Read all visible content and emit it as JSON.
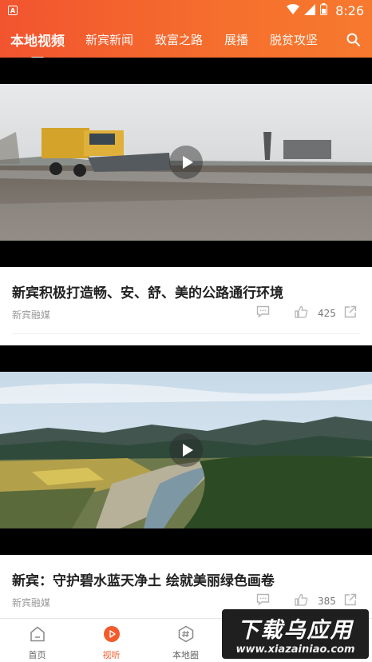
{
  "status_bar": {
    "time": "8:26"
  },
  "top_nav": {
    "tabs": [
      {
        "label": "本地视频",
        "active": true
      },
      {
        "label": "新宾新闻"
      },
      {
        "label": "致富之路"
      },
      {
        "label": "展播"
      },
      {
        "label": "脱贫攻坚"
      }
    ],
    "search_icon": "search-icon"
  },
  "feed": [
    {
      "title": "新宾积极打造畅、安、舒、美的公路通行环境",
      "source": "新宾融媒",
      "likes": "425"
    },
    {
      "title": "新宾：守护碧水蓝天净土  绘就美丽绿色画卷",
      "source": "新宾融媒",
      "likes": "385"
    }
  ],
  "bottom_nav": {
    "items": [
      {
        "label": "首页",
        "icon": "home-icon"
      },
      {
        "label": "视听",
        "icon": "play-icon",
        "active": true
      },
      {
        "label": "本地圈",
        "icon": "hashtag-icon"
      }
    ]
  },
  "watermark": {
    "title": "下载乌应用",
    "url": "www.xiazainiao.com"
  },
  "colors": {
    "accent": "#f35a2c",
    "gradient_start": "#f2542f",
    "gradient_end": "#f7792e"
  }
}
